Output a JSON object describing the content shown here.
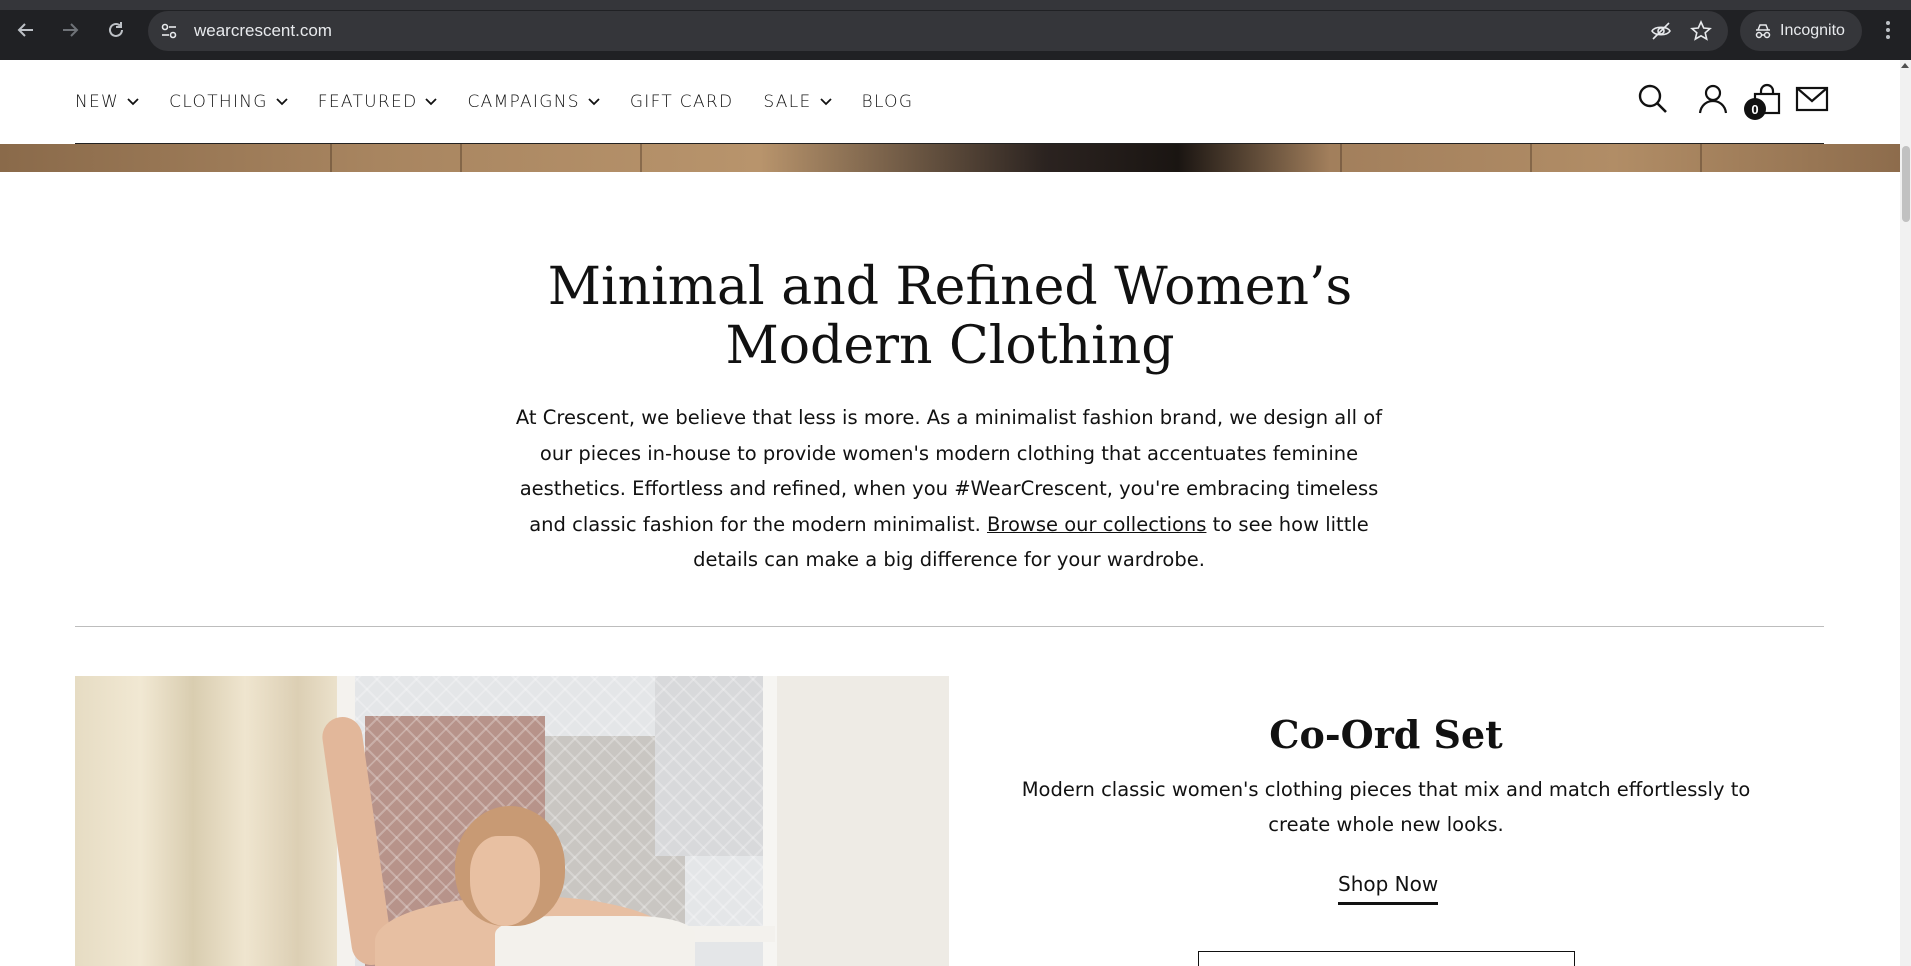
{
  "browser": {
    "url": "wearcrescent.com",
    "profile_label": "Incognito"
  },
  "nav": {
    "items": [
      {
        "label": "NEW",
        "has_dropdown": true
      },
      {
        "label": "CLOTHING",
        "has_dropdown": true
      },
      {
        "label": "FEATURED",
        "has_dropdown": true
      },
      {
        "label": "CAMPAIGNS",
        "has_dropdown": true
      },
      {
        "label": "GIFT CARD",
        "has_dropdown": false
      },
      {
        "label": "SALE",
        "has_dropdown": true
      },
      {
        "label": "BLOG",
        "has_dropdown": false
      }
    ],
    "cart_count": "0",
    "icons": [
      "search-icon",
      "account-icon",
      "cart-icon",
      "mail-icon"
    ]
  },
  "intro": {
    "title_line1": "Minimal and Refined Women’s",
    "title_line2": "Modern Clothing",
    "text_before_link": "At Crescent, we believe that less is more. As a minimalist fashion brand, we design all of our pieces in-house to provide women's modern clothing that accentuates feminine aesthetics. Effortless and refined, when you #WearCrescent, you're embracing timeless and classic fashion for the modern minimalist. ",
    "link_text": "Browse our collections",
    "text_after_link": " to see how little details can make a big difference for your wardrobe."
  },
  "feature": {
    "title": "Co-Ord Set",
    "description": "Modern classic women's clothing pieces that mix and match effortlessly to create whole new looks.",
    "cta": "Shop Now"
  }
}
